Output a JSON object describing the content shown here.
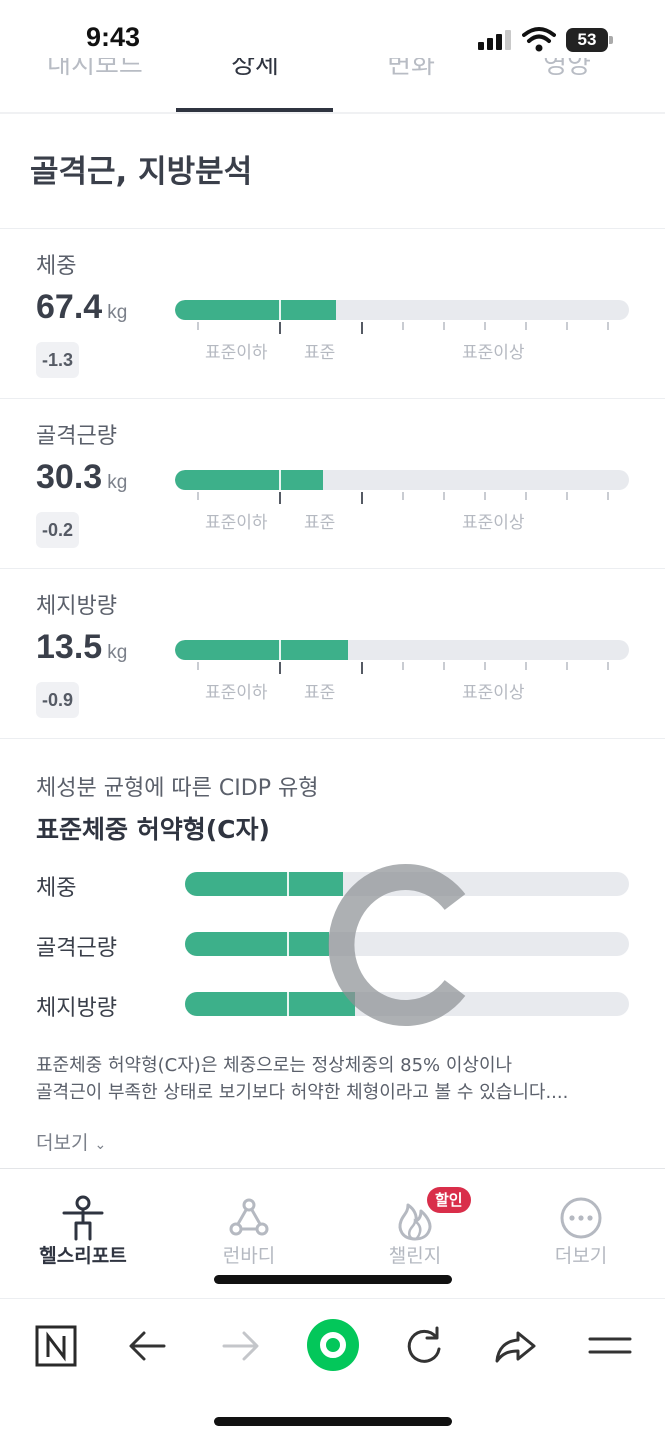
{
  "status": {
    "time": "9:43",
    "battery": "53"
  },
  "tabs": [
    {
      "label": "대시보드"
    },
    {
      "label": "상세"
    },
    {
      "label": "변화"
    },
    {
      "label": "영양"
    }
  ],
  "section": {
    "title": "골격근, 지방분석"
  },
  "metrics": [
    {
      "label": "체중",
      "value": "67.4",
      "unit": "kg",
      "change": "-1.3",
      "fill_ratio": 0.355
    },
    {
      "label": "골격근량",
      "value": "30.3",
      "unit": "kg",
      "change": "-0.2",
      "fill_ratio": 0.326
    },
    {
      "label": "체지방량",
      "value": "13.5",
      "unit": "kg",
      "change": "-0.9",
      "fill_ratio": 0.381
    }
  ],
  "zones": {
    "below": "표준이하",
    "standard": "표준",
    "above": "표준이상"
  },
  "cidp": {
    "subtitle": "체성분 균형에 따른 CIDP 유형",
    "type": "표준체중 허약형(C자)",
    "rows": [
      {
        "label": "체중",
        "fill_ratio": 0.355
      },
      {
        "label": "골격근량",
        "fill_ratio": 0.325
      },
      {
        "label": "체지방량",
        "fill_ratio": 0.383
      }
    ],
    "description_line1": "표준체중 허약형(C자)은 체중으로는 정상체중의 85% 이상이나",
    "description_line2": "골격근이 부족한 상태로 보기보다 허약한 체형이라고 볼 수 있습니다....",
    "more": "더보기"
  },
  "app_nav": [
    {
      "label": "헬스리포트",
      "icon": "health-report-icon"
    },
    {
      "label": "런바디",
      "icon": "runbody-icon"
    },
    {
      "label": "챌린지",
      "icon": "challenge-flame-icon",
      "badge": "할인"
    },
    {
      "label": "더보기",
      "icon": "more-dots-icon"
    }
  ],
  "colors": {
    "accent": "#3db08a",
    "track": "#e8eaee",
    "badge": "#d92e4a",
    "browser_green": "#03c75a"
  }
}
